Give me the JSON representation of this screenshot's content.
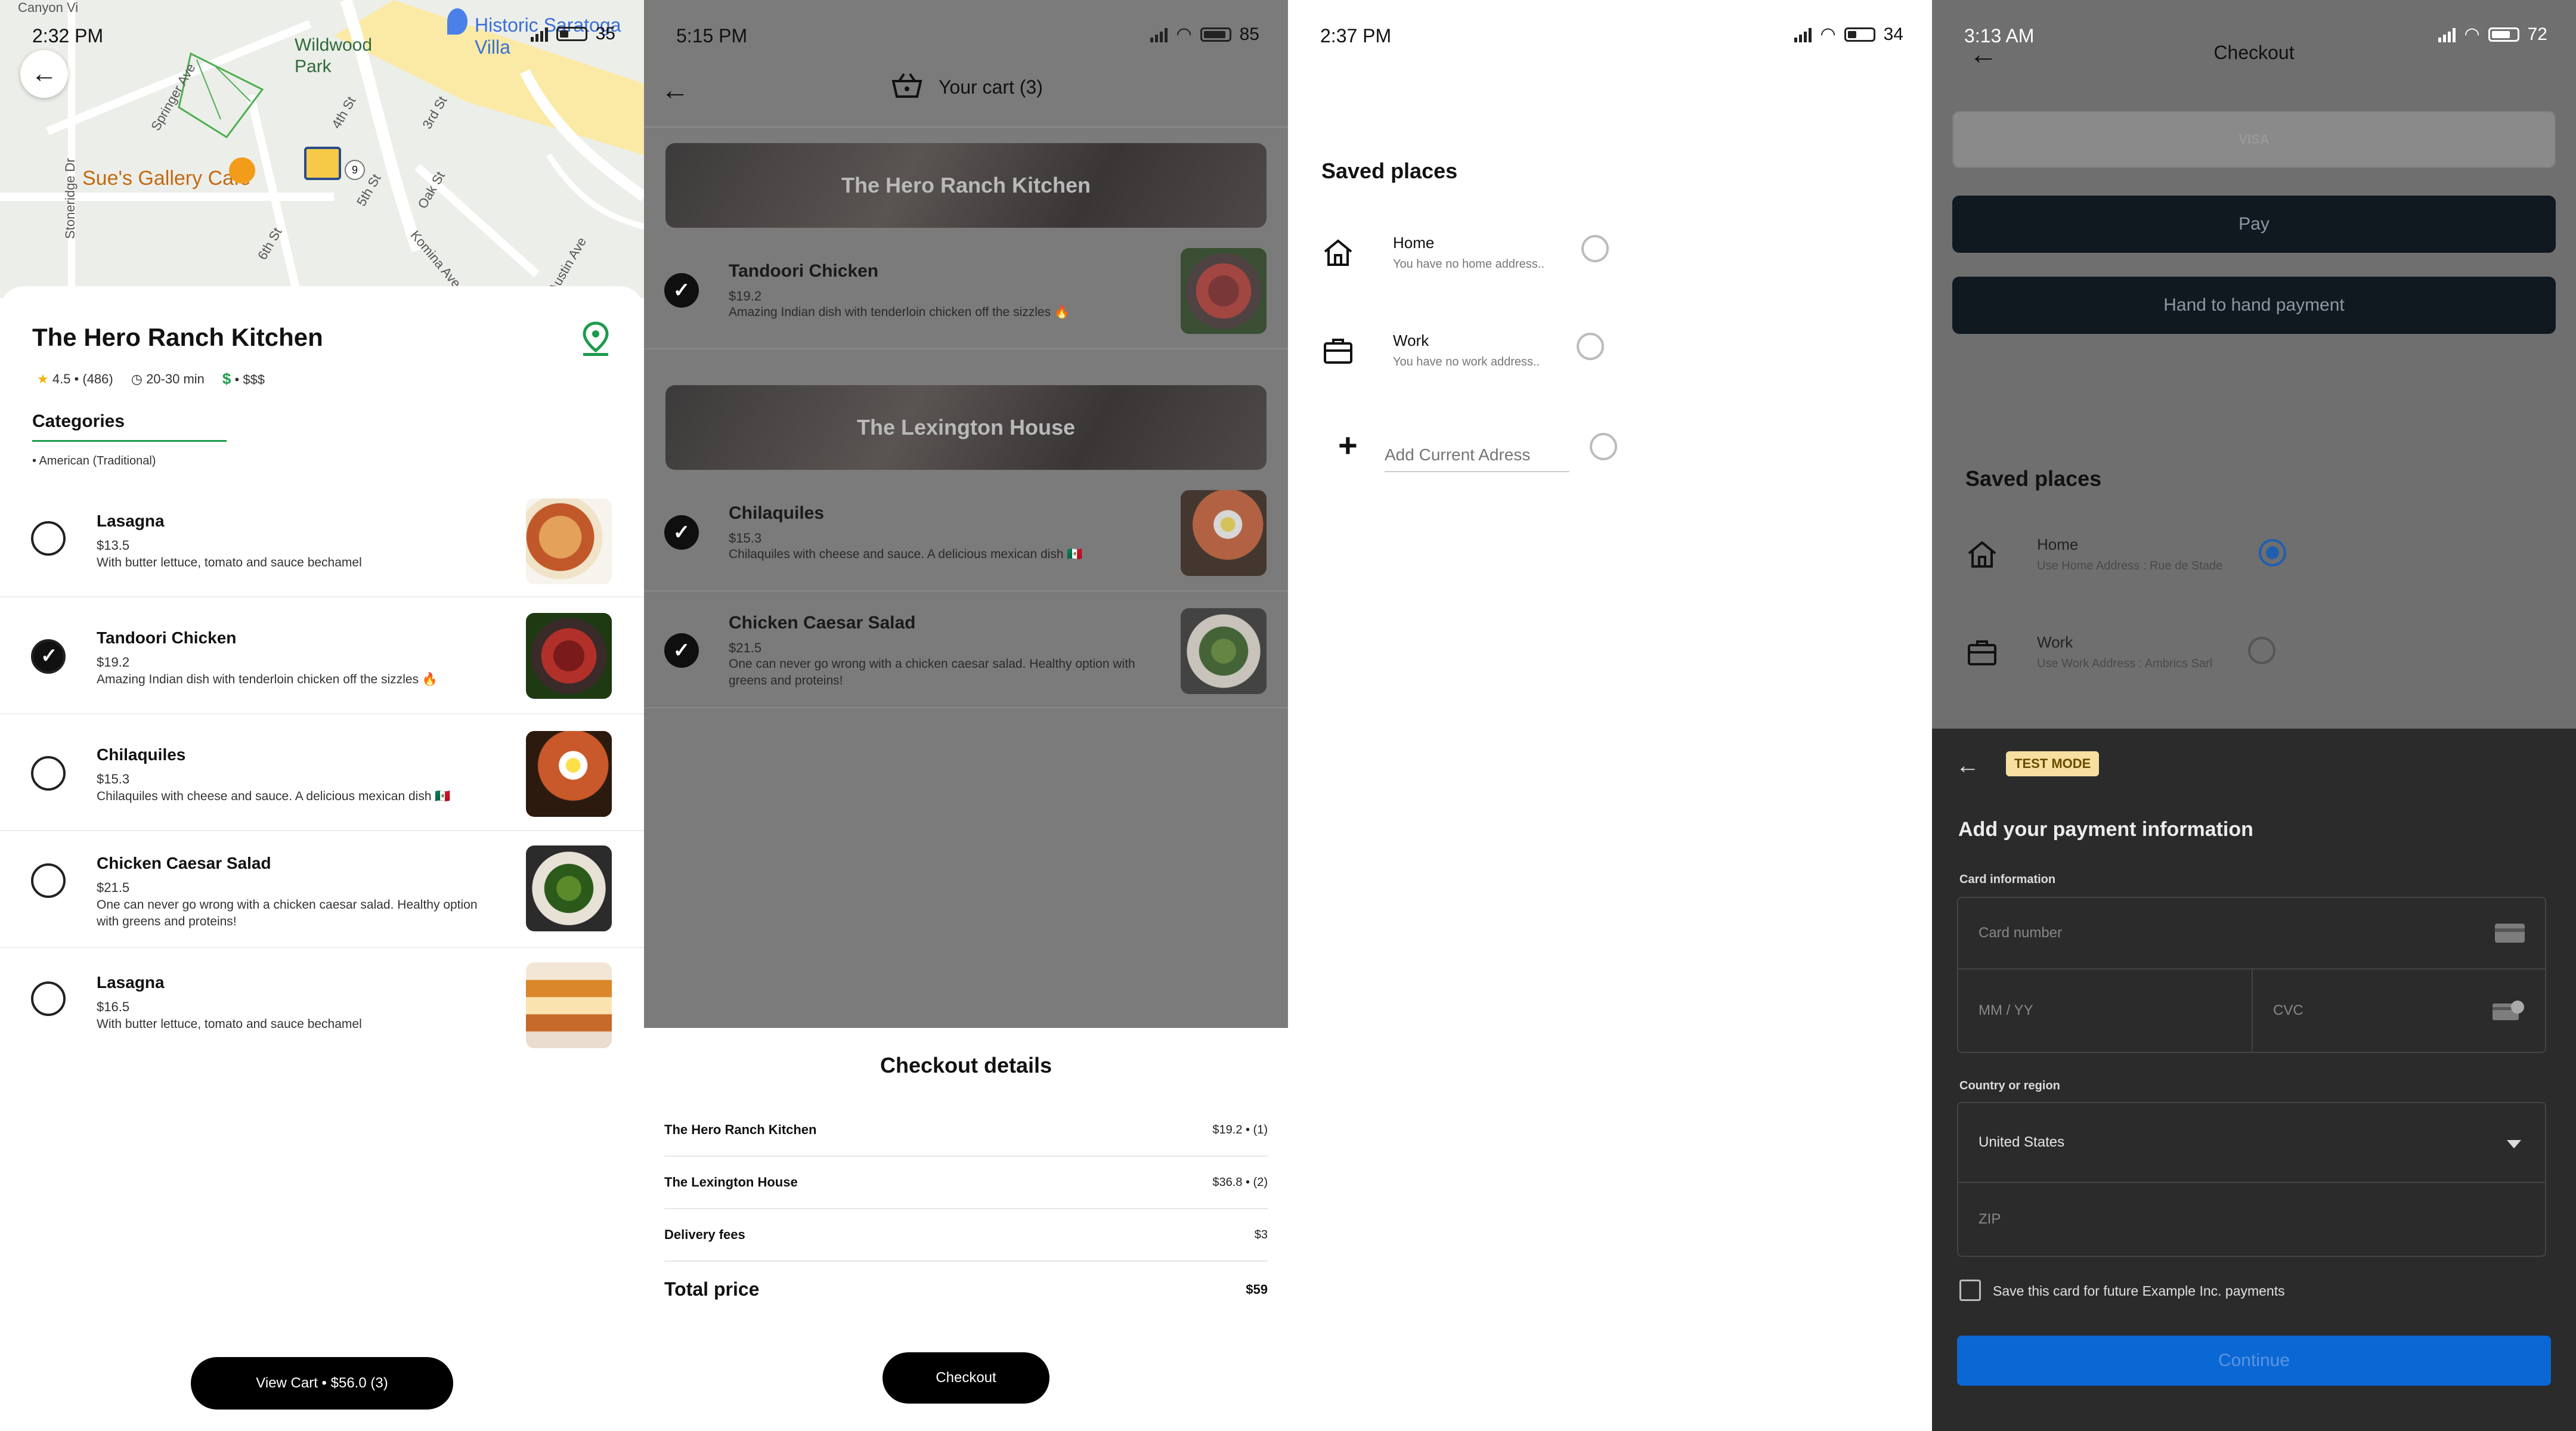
{
  "screen1": {
    "status": {
      "time": "2:32 PM",
      "battery": "35"
    },
    "map": {
      "labels": {
        "park": "Wildwood\nPark",
        "cafe": "Sue's Gallery Cafe",
        "historic": "Historic Saratoga Villa",
        "canyon": "Canyon Vi",
        "badge": "9"
      },
      "streets": [
        "Springer Ave",
        "4th St",
        "3rd St",
        "5th St",
        "Oak St",
        "6th St",
        "Komina Ave",
        "Stoneridge Dr",
        "Austin Ave"
      ]
    },
    "restaurant": {
      "name": "The Hero Ranch Kitchen",
      "rating": "4.5 • (486)",
      "time": "20-30 min",
      "price_tier": "• $$$",
      "dollar": "$"
    },
    "categories": {
      "heading": "Categories",
      "sub": "• American (Traditional)"
    },
    "items": [
      {
        "name": "Lasagna",
        "price": "$13.5",
        "desc": "With butter lettuce, tomato and sauce bechamel",
        "selected": false
      },
      {
        "name": "Tandoori Chicken",
        "price": "$19.2",
        "desc": "Amazing Indian dish with tenderloin chicken off the sizzles 🔥",
        "selected": true
      },
      {
        "name": "Chilaquiles",
        "price": "$15.3",
        "desc": "Chilaquiles with cheese and sauce. A delicious mexican dish 🇲🇽",
        "selected": false
      },
      {
        "name": "Chicken Caesar Salad",
        "price": "$21.5",
        "desc": "One can never go wrong with a chicken caesar salad. Healthy option with greens and proteins!",
        "selected": false
      },
      {
        "name": "Lasagna",
        "price": "$16.5",
        "desc": "With butter lettuce, tomato and sauce bechamel",
        "selected": false
      }
    ],
    "view_cart": "View Cart • $56.0 (3)"
  },
  "screen2": {
    "status": {
      "time": "5:15 PM",
      "battery": "85"
    },
    "header_title": "Your cart (3)",
    "restaurants": [
      {
        "name": "The Hero Ranch Kitchen",
        "items": [
          {
            "name": "Tandoori Chicken",
            "price": "$19.2",
            "desc": "Amazing Indian dish with tenderloin chicken off the sizzles 🔥"
          }
        ]
      },
      {
        "name": "The Lexington House",
        "items": [
          {
            "name": "Chilaquiles",
            "price": "$15.3",
            "desc": "Chilaquiles with cheese and sauce. A delicious mexican dish 🇲🇽"
          },
          {
            "name": "Chicken Caesar Salad",
            "price": "$21.5",
            "desc": "One can never go wrong with a chicken caesar salad. Healthy option with greens and proteins!"
          }
        ]
      }
    ],
    "checkout": {
      "title": "Checkout details",
      "rows": [
        {
          "label": "The Hero Ranch Kitchen",
          "value": "$19.2 • (1)"
        },
        {
          "label": "The Lexington House",
          "value": "$36.8 • (2)"
        },
        {
          "label": "Delivery fees",
          "value": "$3"
        }
      ],
      "total_label": "Total price",
      "total_value": "$59",
      "button": "Checkout"
    }
  },
  "screen3": {
    "status": {
      "time": "2:37 PM",
      "battery": "34"
    },
    "heading": "Saved places",
    "places": [
      {
        "title": "Home",
        "sub": "You have no home address.."
      },
      {
        "title": "Work",
        "sub": "You have no work address.."
      }
    ],
    "add_placeholder": "Add Current Adress"
  },
  "screen4": {
    "status": {
      "time": "3:13 AM",
      "battery": "72"
    },
    "title": "Checkout",
    "visa": "VISA",
    "pay_button": "Pay",
    "hand_button": "Hand to hand payment",
    "saved_heading": "Saved places",
    "places": [
      {
        "title": "Home",
        "sub": "Use Home Address : Rue de Stade"
      },
      {
        "title": "Work",
        "sub": "Use Work Address : Ambrics Sarl"
      }
    ],
    "payment": {
      "badge": "TEST MODE",
      "title": "Add your payment information",
      "card_label": "Card information",
      "card_number_placeholder": "Card number",
      "expiry_placeholder": "MM / YY",
      "cvc_placeholder": "CVC",
      "country_label": "Country or region",
      "country_value": "United States",
      "zip_placeholder": "ZIP",
      "save_label": "Save this card for future Example Inc. payments",
      "continue": "Continue"
    }
  },
  "colors": {
    "accent_green": "#1e9a4c",
    "continue_blue": "#0b67d4",
    "badge_yellow": "#f6dfa0"
  }
}
